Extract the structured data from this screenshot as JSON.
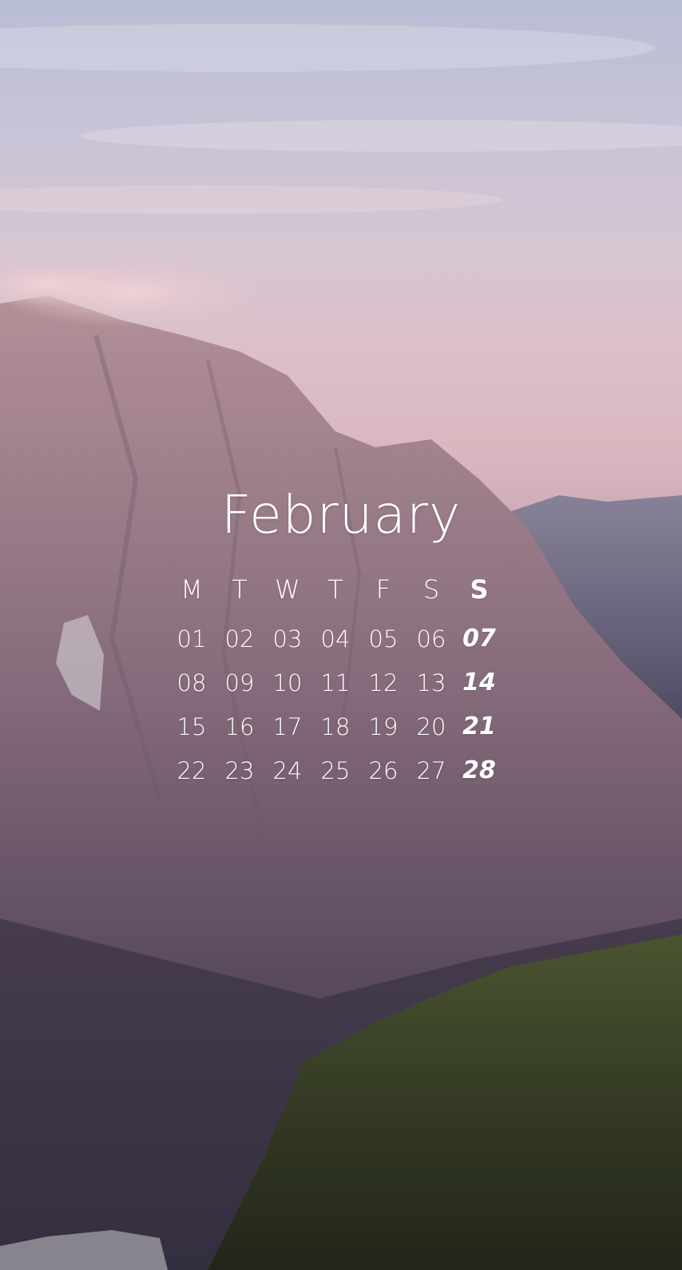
{
  "calendar": {
    "month": "February",
    "weekday_headers": [
      "M",
      "T",
      "W",
      "T",
      "F",
      "S",
      "S"
    ],
    "weeks": [
      [
        "01",
        "02",
        "03",
        "04",
        "05",
        "06",
        "07"
      ],
      [
        "08",
        "09",
        "10",
        "11",
        "12",
        "13",
        "14"
      ],
      [
        "15",
        "16",
        "17",
        "18",
        "19",
        "20",
        "21"
      ],
      [
        "22",
        "23",
        "24",
        "25",
        "26",
        "27",
        "28"
      ]
    ]
  },
  "colors": {
    "text": "#ffffff",
    "sky_top": "#b9bdd4",
    "sky_pink": "#dcbfc8",
    "mountain": "#8a6f7d",
    "grass": "#3f4a2a"
  }
}
